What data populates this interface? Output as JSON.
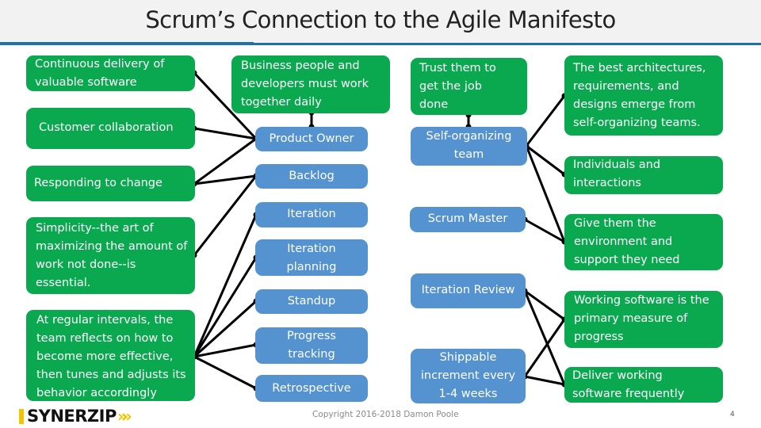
{
  "slide": {
    "title": "Scrum’s Connection to the Agile Manifesto",
    "copyright": "Copyright 2016-2018 Damon Poole",
    "page_number": "4",
    "logo": {
      "text": "SYNERZIP",
      "chevrons": "»»",
      "accent_color": "#f2c500"
    }
  },
  "colors": {
    "principle_green": "#0aa84f",
    "scrum_blue": "#5592d0",
    "header_rule": "#1f6fa8",
    "connector": "#000000"
  },
  "manifesto_items": {
    "continuous_delivery": "Continuous delivery of valuable software",
    "customer_collaboration": "Customer collaboration",
    "responding_to_change": "Responding to change",
    "simplicity": "Simplicity--the art of maximizing the amount of work not done--is essential.",
    "regular_intervals": "At regular intervals, the team reflects on how to become more effective, then tunes and adjusts its behavior accordingly",
    "business_people": "Business people and developers must work together daily",
    "trust_them": "Trust them to get the job done",
    "best_architectures": "The best architectures, requirements, and designs emerge from self-organizing teams.",
    "individuals": "Individuals and interactions",
    "give_environment": "Give them the environment and support they need",
    "working_software": "Working software is the primary measure of progress",
    "deliver_frequently": "Deliver working software frequently"
  },
  "scrum_items": {
    "product_owner": "Product Owner",
    "backlog": "Backlog",
    "iteration": "Iteration",
    "iteration_planning": "Iteration planning",
    "standup": "Standup",
    "progress_tracking": "Progress tracking",
    "retrospective": "Retrospective",
    "self_organizing_team": "Self-organizing team",
    "scrum_master": "Scrum Master",
    "iteration_review": "Iteration Review",
    "shippable_increment": "Shippable increment every 1-4 weeks"
  },
  "connections": [
    [
      "continuous_delivery",
      "product_owner"
    ],
    [
      "customer_collaboration",
      "product_owner"
    ],
    [
      "responding_to_change",
      "product_owner"
    ],
    [
      "responding_to_change",
      "backlog"
    ],
    [
      "simplicity",
      "backlog"
    ],
    [
      "regular_intervals",
      "iteration"
    ],
    [
      "regular_intervals",
      "iteration_planning"
    ],
    [
      "regular_intervals",
      "standup"
    ],
    [
      "regular_intervals",
      "progress_tracking"
    ],
    [
      "regular_intervals",
      "retrospective"
    ],
    [
      "business_people",
      "product_owner"
    ],
    [
      "trust_them",
      "self_organizing_team"
    ],
    [
      "self_organizing_team",
      "best_architectures"
    ],
    [
      "self_organizing_team",
      "individuals"
    ],
    [
      "self_organizing_team",
      "give_environment"
    ],
    [
      "scrum_master",
      "give_environment"
    ],
    [
      "iteration_review",
      "working_software"
    ],
    [
      "iteration_review",
      "deliver_frequently"
    ],
    [
      "shippable_increment",
      "working_software"
    ],
    [
      "shippable_increment",
      "deliver_frequently"
    ]
  ]
}
